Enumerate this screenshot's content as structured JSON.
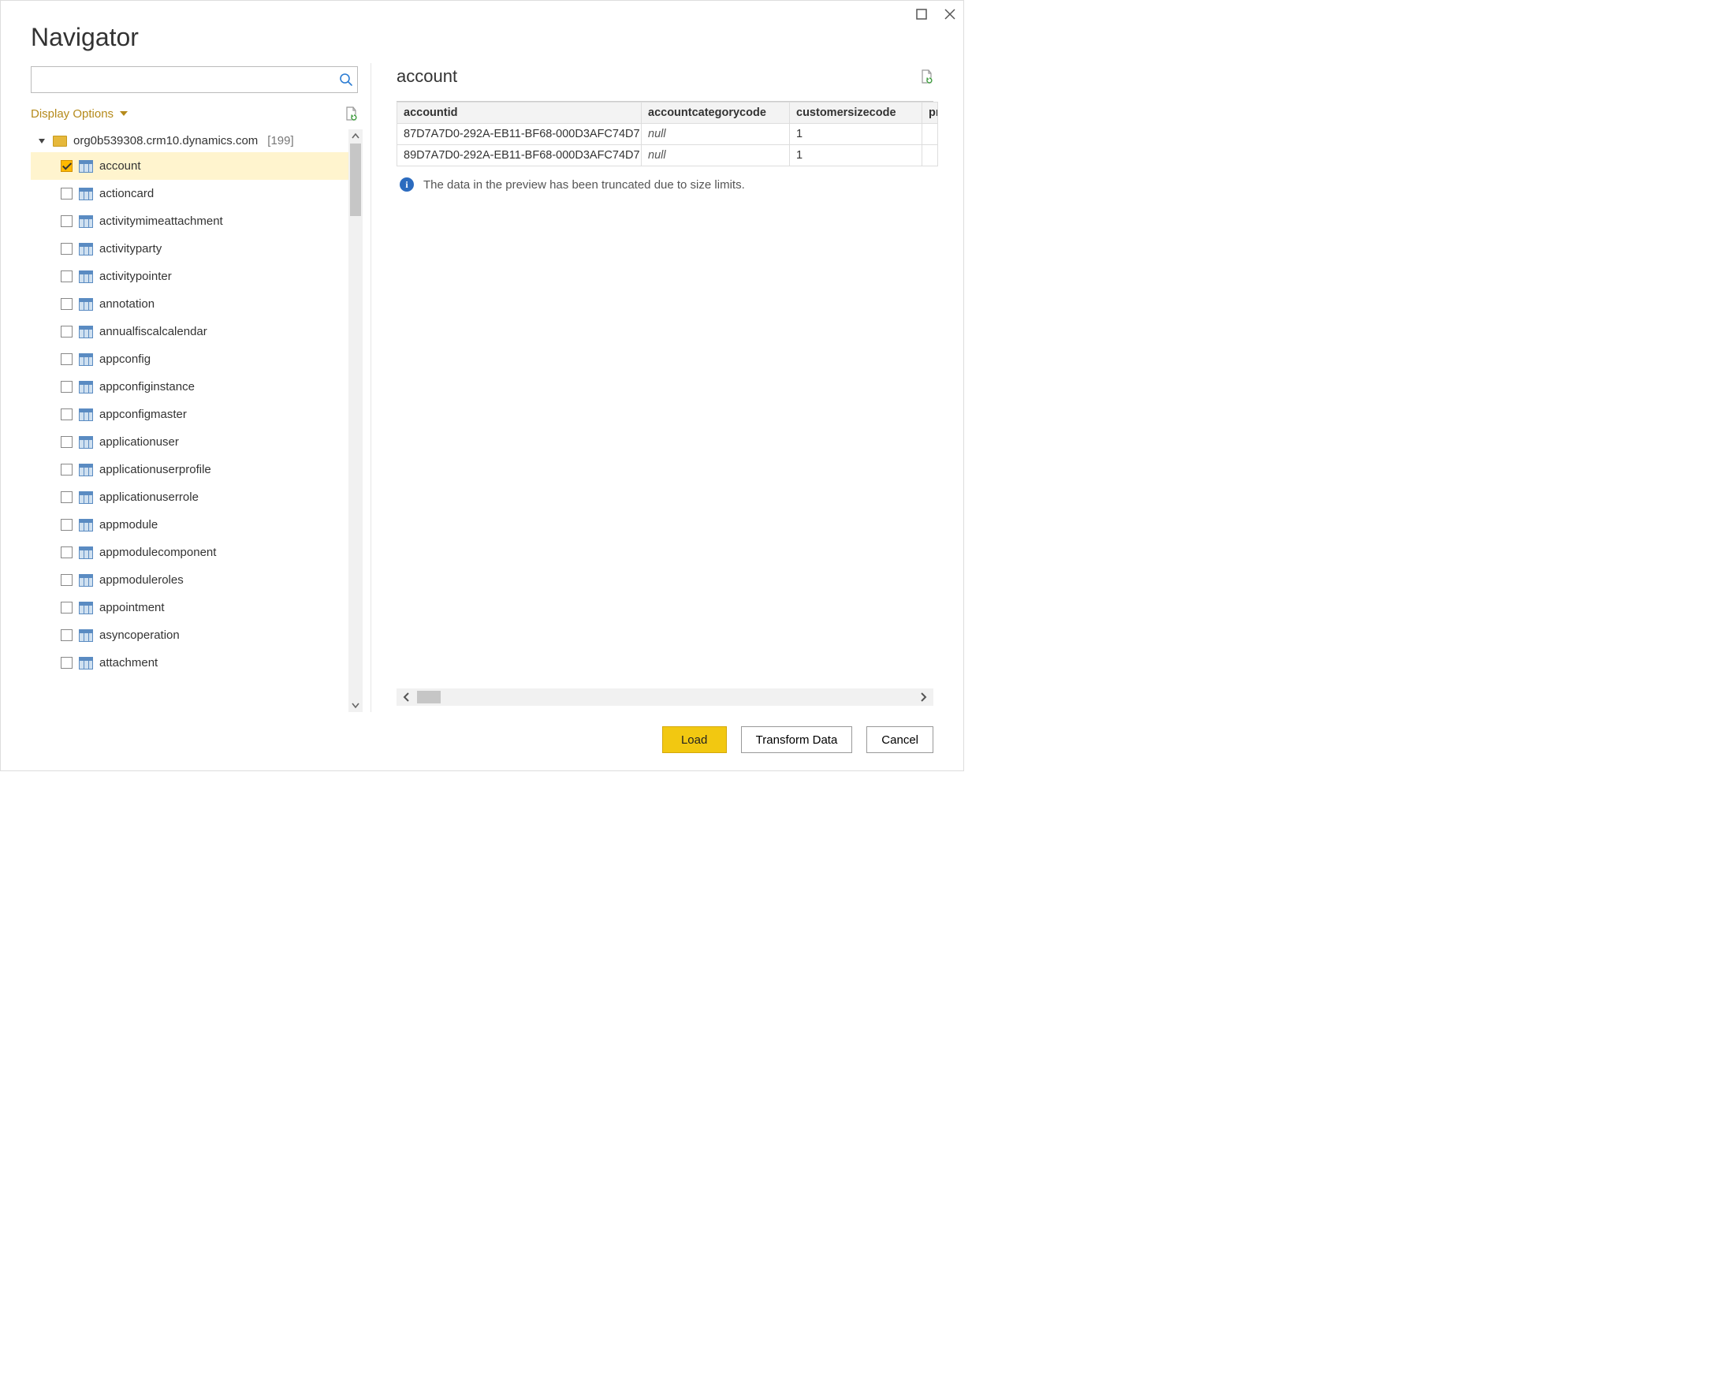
{
  "dialog": {
    "title": "Navigator"
  },
  "search": {
    "placeholder": ""
  },
  "displayOptions": {
    "label": "Display Options"
  },
  "tree": {
    "root": {
      "label": "org0b539308.crm10.dynamics.com",
      "count": "[199]"
    },
    "items": [
      {
        "label": "account",
        "checked": true,
        "selected": true
      },
      {
        "label": "actioncard",
        "checked": false,
        "selected": false
      },
      {
        "label": "activitymimeattachment",
        "checked": false,
        "selected": false
      },
      {
        "label": "activityparty",
        "checked": false,
        "selected": false
      },
      {
        "label": "activitypointer",
        "checked": false,
        "selected": false
      },
      {
        "label": "annotation",
        "checked": false,
        "selected": false
      },
      {
        "label": "annualfiscalcalendar",
        "checked": false,
        "selected": false
      },
      {
        "label": "appconfig",
        "checked": false,
        "selected": false
      },
      {
        "label": "appconfiginstance",
        "checked": false,
        "selected": false
      },
      {
        "label": "appconfigmaster",
        "checked": false,
        "selected": false
      },
      {
        "label": "applicationuser",
        "checked": false,
        "selected": false
      },
      {
        "label": "applicationuserprofile",
        "checked": false,
        "selected": false
      },
      {
        "label": "applicationuserrole",
        "checked": false,
        "selected": false
      },
      {
        "label": "appmodule",
        "checked": false,
        "selected": false
      },
      {
        "label": "appmodulecomponent",
        "checked": false,
        "selected": false
      },
      {
        "label": "appmoduleroles",
        "checked": false,
        "selected": false
      },
      {
        "label": "appointment",
        "checked": false,
        "selected": false
      },
      {
        "label": "asyncoperation",
        "checked": false,
        "selected": false
      },
      {
        "label": "attachment",
        "checked": false,
        "selected": false
      }
    ]
  },
  "preview": {
    "title": "account",
    "columns": [
      "accountid",
      "accountcategorycode",
      "customersizecode",
      "pr"
    ],
    "rows": [
      {
        "accountid": "87D7A7D0-292A-EB11-BF68-000D3AFC74D7",
        "accountcategorycode": "null",
        "customersizecode": "1"
      },
      {
        "accountid": "89D7A7D0-292A-EB11-BF68-000D3AFC74D7",
        "accountcategorycode": "null",
        "customersizecode": "1"
      }
    ],
    "infoMessage": "The data in the preview has been truncated due to size limits."
  },
  "footer": {
    "load": "Load",
    "transform": "Transform Data",
    "cancel": "Cancel"
  }
}
